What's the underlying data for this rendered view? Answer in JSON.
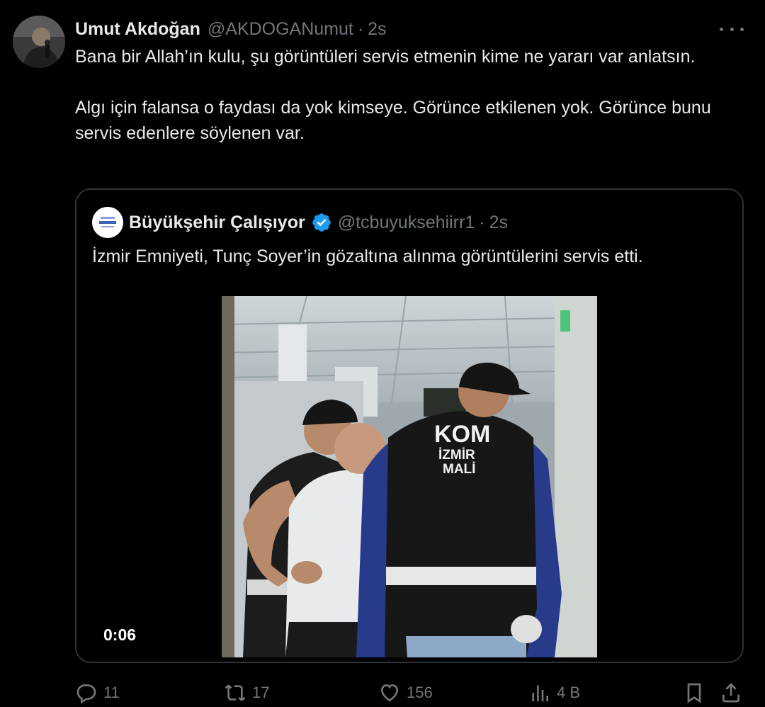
{
  "tweet": {
    "author_name": "Umut Akdoğan",
    "author_handle": "@AKDOGANumut",
    "separator": "·",
    "time": "2s",
    "paragraphs": [
      "Bana bir Allah’ın kulu, şu görüntüleri servis etmenin kime ne yararı var anlatsın.",
      "Algı için falansa o faydası da yok kimseye. Görünce etkilenen yok. Görünce bunu servis edenlere söylenen var."
    ]
  },
  "quote": {
    "author_name": "Büyükşehir Çalışıyor",
    "author_handle": "@tcbuyuksehiirr1",
    "separator": "·",
    "time": "2s",
    "text": "İzmir Emniyeti, Tunç Soyer’in gözaltına alınma görüntülerini servis etti.",
    "video": {
      "duration": "0:06",
      "vest_text_1": "KOM",
      "vest_text_2": "İZMİR",
      "vest_text_3": "MALİ"
    }
  },
  "actions": {
    "replies": "11",
    "reposts": "17",
    "likes": "156",
    "views": "4 B"
  },
  "icons": {
    "more": "more-icon",
    "verified": "verified-badge-icon",
    "reply": "reply-icon",
    "repost": "repost-icon",
    "like": "heart-icon",
    "views": "views-icon",
    "bookmark": "bookmark-icon",
    "share": "share-icon"
  },
  "colors": {
    "background": "#000000",
    "text": "#e7e9ea",
    "muted": "#71767b",
    "border": "#2f3336",
    "verified": "#1d9bf0"
  }
}
